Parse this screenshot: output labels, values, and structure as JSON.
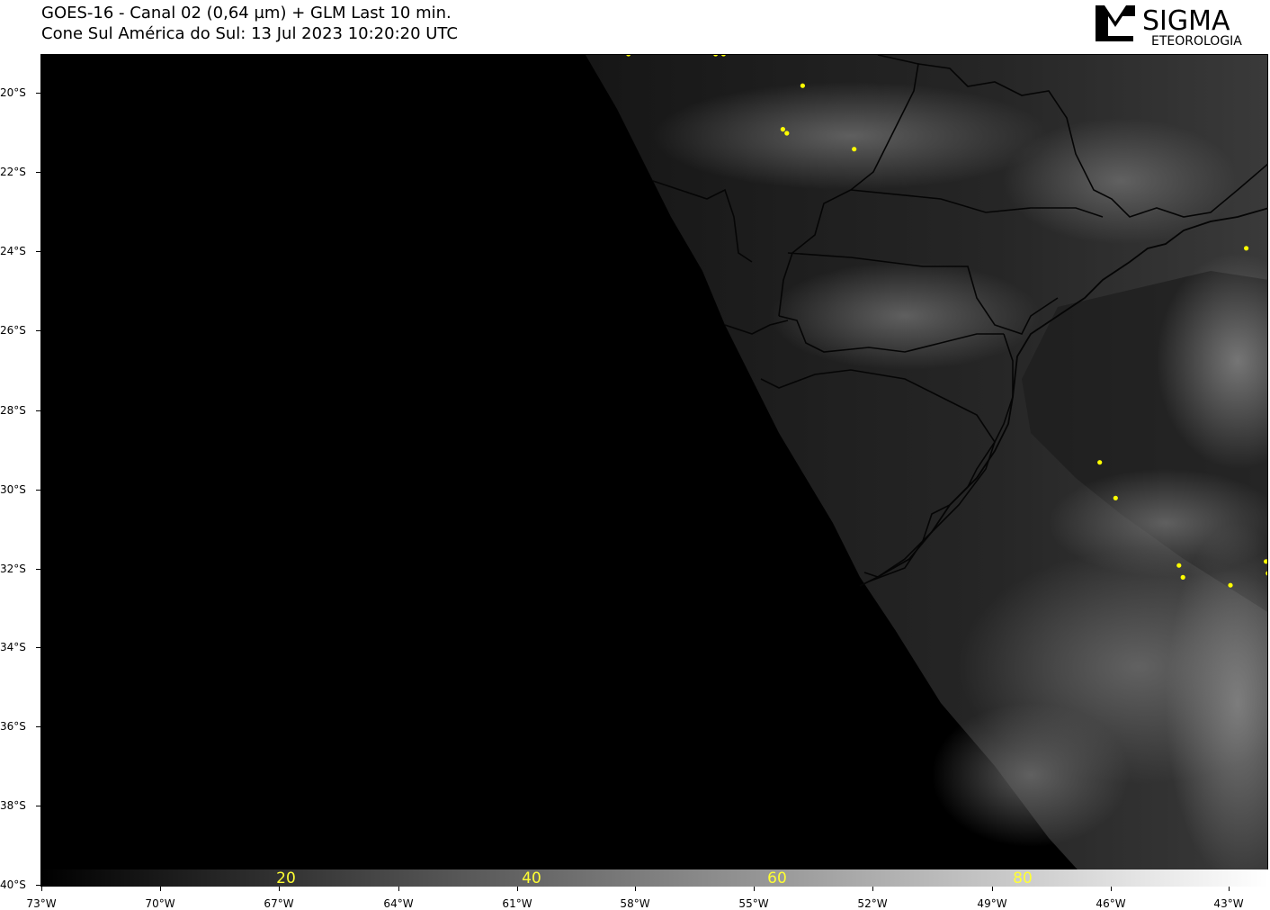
{
  "header": {
    "line1": "GOES-16 - Canal 02 (0,64 µm) + GLM Last 10 min.",
    "line2": "Cone Sul América do Sul:  13 Jul 2023 10:20:20 UTC"
  },
  "logo": {
    "word1": "SIGMA",
    "word2": "ETEOROLOGIA",
    "icon": "sigma-m-logo-icon"
  },
  "axes": {
    "lat_labels": [
      "20°S",
      "22°S",
      "24°S",
      "26°S",
      "28°S",
      "30°S",
      "32°S",
      "34°S",
      "36°S",
      "38°S",
      "40°S"
    ],
    "lon_labels": [
      "73°W",
      "70°W",
      "67°W",
      "64°W",
      "61°W",
      "58°W",
      "55°W",
      "52°W",
      "49°W",
      "46°W",
      "43°W"
    ]
  },
  "colorbar": {
    "labels": [
      "20",
      "40",
      "60",
      "80"
    ],
    "label_color": "#ffff33"
  },
  "lightning": {
    "color": "#ffff00",
    "points": [
      {
        "lon": -58.2,
        "lat": -19.0
      },
      {
        "lon": -56.0,
        "lat": -19.0
      },
      {
        "lon": -55.8,
        "lat": -19.0
      },
      {
        "lon": -53.8,
        "lat": -19.8
      },
      {
        "lon": -54.3,
        "lat": -20.9
      },
      {
        "lon": -54.2,
        "lat": -21.0
      },
      {
        "lon": -52.5,
        "lat": -21.4
      },
      {
        "lon": -42.6,
        "lat": -23.9
      },
      {
        "lon": -46.3,
        "lat": -29.3
      },
      {
        "lon": -45.9,
        "lat": -30.2
      },
      {
        "lon": -44.3,
        "lat": -31.9
      },
      {
        "lon": -44.2,
        "lat": -32.2
      },
      {
        "lon": -43.0,
        "lat": -32.4
      },
      {
        "lon": -42.1,
        "lat": -31.8
      },
      {
        "lon": -42.05,
        "lat": -32.1
      }
    ]
  }
}
